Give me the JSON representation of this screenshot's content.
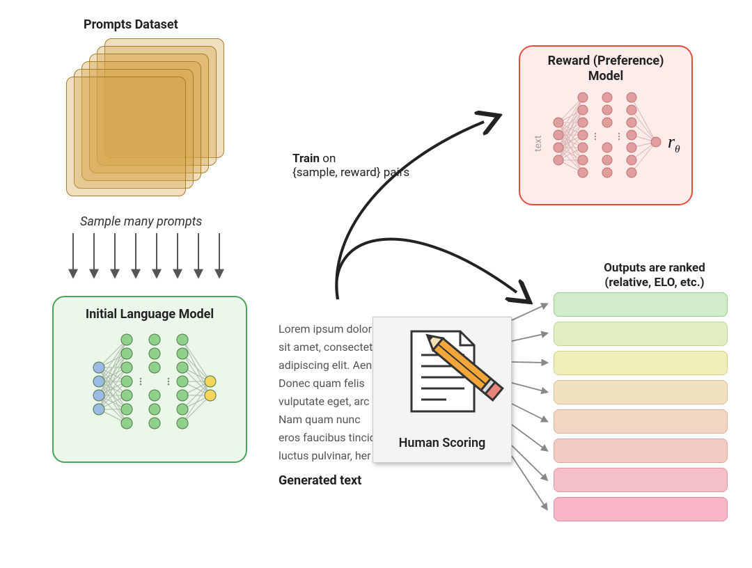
{
  "headings": {
    "prompts_dataset": "Prompts Dataset",
    "sample_many": "Sample many prompts",
    "ilm_title": "Initial Language Model",
    "rm_title_l1": "Reward (Preference)",
    "rm_title_l2": "Model",
    "rm_side": "text",
    "rm_output": "r",
    "rm_output_sub": "θ",
    "generated_text": "Generated text",
    "human_scoring": "Human Scoring",
    "outputs_ranked_l1": "Outputs are ranked",
    "outputs_ranked_l2": "(relative, ELO, etc.)",
    "train_l1_strong": "Train",
    "train_l1_rest": " on",
    "train_l2": "{sample, reward} pairs"
  },
  "generated": {
    "l1": "Lorem ipsum dolor",
    "l2": "sit amet, consectet",
    "l3": "adipiscing elit. Aen",
    "l4": "Donec quam felis",
    "l5": "vulputate eget, arc",
    "l6": "Nam quam nunc",
    "l7": "eros faucibus tincid",
    "l8": "luctus pulvinar, her"
  },
  "rank_bars": [
    {
      "fill": "#d1ecc9",
      "stroke": "#95cf8d"
    },
    {
      "fill": "#e0eec2",
      "stroke": "#bcd59a"
    },
    {
      "fill": "#f0efba",
      "stroke": "#d1d18e"
    },
    {
      "fill": "#f1e1c1",
      "stroke": "#d3c49c"
    },
    {
      "fill": "#f2d6c2",
      "stroke": "#d7b69c"
    },
    {
      "fill": "#f4cbc3",
      "stroke": "#dba8a0"
    },
    {
      "fill": "#f5c0c5",
      "stroke": "#df99a3"
    },
    {
      "fill": "#f7b5c6",
      "stroke": "#e28ba7"
    }
  ]
}
